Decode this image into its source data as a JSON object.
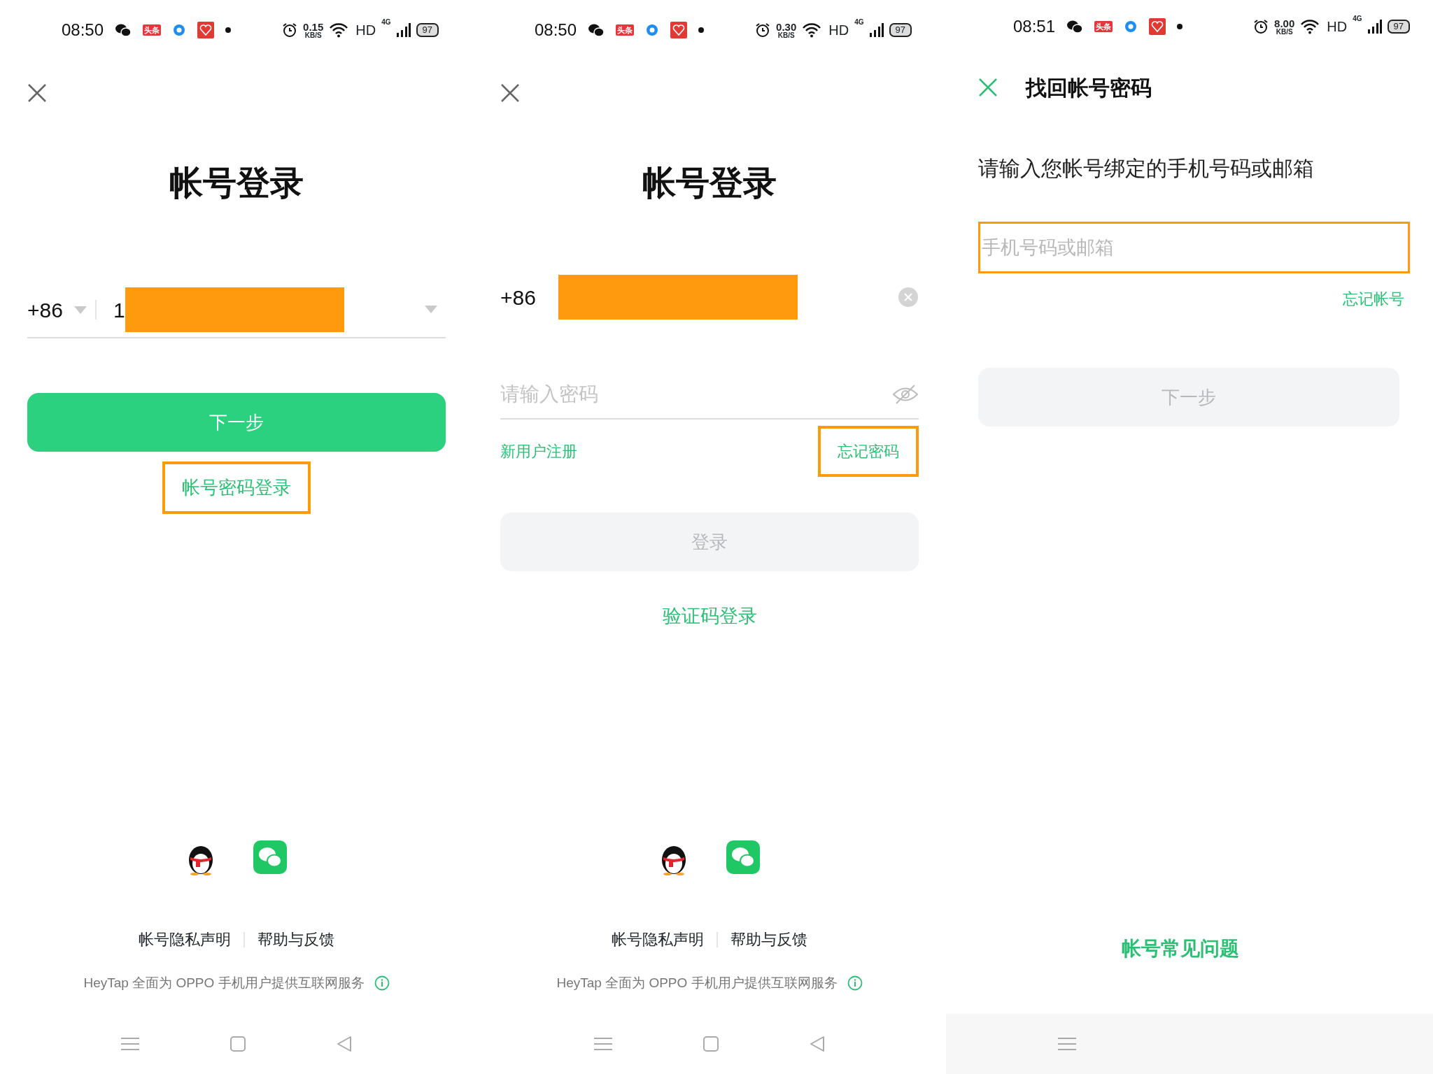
{
  "panels": [
    {
      "kind": "phone_login",
      "status_bar": {
        "time": "08:50",
        "badge": "头条",
        "speed": "0.15",
        "speed_unit": "KB/S",
        "network": "HD",
        "signal": "4G",
        "battery": "97"
      },
      "title": "帐号登录",
      "country_code": "+86",
      "phone": {
        "value": "1",
        "redacted": true
      },
      "primary_button": {
        "label": "下一步",
        "disabled": false
      },
      "switch_link": {
        "label": "帐号密码登录",
        "highlighted": true
      },
      "footer_links": [
        "帐号隐私声明",
        "帮助与反馈"
      ],
      "notice": "HeyTap 全面为 OPPO 手机用户提供互联网服务",
      "nav_shaded": false
    },
    {
      "kind": "password_login",
      "status_bar": {
        "time": "08:50",
        "badge": "头条",
        "speed": "0.30",
        "speed_unit": "KB/S",
        "network": "HD",
        "signal": "4G",
        "battery": "97"
      },
      "title": "帐号登录",
      "country_code": "+86",
      "phone": {
        "redacted": true
      },
      "password": {
        "placeholder": "请输入密码"
      },
      "links": [
        {
          "label": "新用户注册",
          "highlighted": false
        },
        {
          "label": "忘记密码",
          "highlighted": true
        }
      ],
      "primary_button": {
        "label": "登录",
        "disabled": true
      },
      "switch_link": {
        "label": "验证码登录",
        "highlighted": false
      },
      "footer_links": [
        "帐号隐私声明",
        "帮助与反馈"
      ],
      "notice": "HeyTap 全面为 OPPO 手机用户提供互联网服务",
      "nav_shaded": false
    },
    {
      "kind": "recover",
      "status_bar": {
        "time": "08:51",
        "badge": "头条",
        "speed": "8.00",
        "speed_unit": "KB/S",
        "network": "HD",
        "signal": "4G",
        "battery": "97"
      },
      "title": "找回帐号密码",
      "prompt": "请输入您帐号绑定的手机号码或邮箱",
      "input": {
        "placeholder": "手机号码或邮箱",
        "highlighted": true
      },
      "forgot_link": {
        "label": "忘记帐号",
        "highlighted": false
      },
      "primary_button": {
        "label": "下一步",
        "disabled": true
      },
      "faq_link": "帐号常见问题",
      "nav_shaded": true
    }
  ]
}
